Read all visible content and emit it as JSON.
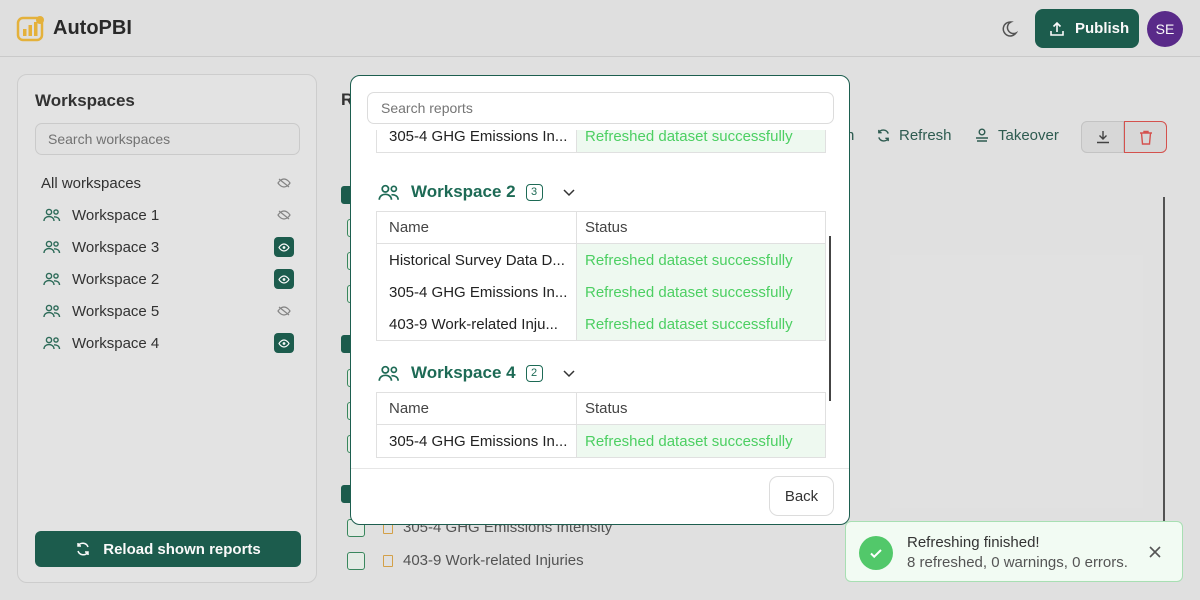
{
  "app": {
    "title": "AutoPBI"
  },
  "header": {
    "publish_label": "Publish",
    "avatar_initials": "SE"
  },
  "sidebar": {
    "title": "Workspaces",
    "search_placeholder": "Search workspaces",
    "all_label": "All workspaces",
    "items": [
      {
        "label": "Workspace 1",
        "visible": false
      },
      {
        "label": "Workspace 3",
        "visible": true
      },
      {
        "label": "Workspace 2",
        "visible": true
      },
      {
        "label": "Workspace 5",
        "visible": false
      },
      {
        "label": "Workspace 4",
        "visible": true
      }
    ],
    "reload_label": "Reload shown reports"
  },
  "main": {
    "title_partial": "R",
    "toolbar": {
      "partial_label": "n",
      "refresh_label": "Refresh",
      "takeover_label": "Takeover"
    },
    "rows": [
      "305-4 GHG Emissions Intensity",
      "403-9 Work-related Injuries"
    ]
  },
  "modal": {
    "search_placeholder": "Search reports",
    "top_row": {
      "name": "305-4 GHG Emissions In...",
      "status": "Refreshed dataset successfully"
    },
    "groups": [
      {
        "name": "Workspace 2",
        "count": "3",
        "col_name": "Name",
        "col_status": "Status",
        "rows": [
          {
            "name": "Historical Survey Data D...",
            "status": "Refreshed dataset successfully"
          },
          {
            "name": "305-4 GHG Emissions In...",
            "status": "Refreshed dataset successfully"
          },
          {
            "name": "403-9 Work-related Inju...",
            "status": "Refreshed dataset successfully"
          }
        ]
      },
      {
        "name": "Workspace 4",
        "count": "2",
        "col_name": "Name",
        "col_status": "Status",
        "rows": [
          {
            "name": "305-4 GHG Emissions In...",
            "status": "Refreshed dataset successfully"
          }
        ]
      }
    ],
    "back_label": "Back"
  },
  "toast": {
    "title": "Refreshing finished!",
    "message": "8 refreshed, 0 warnings, 0 errors."
  },
  "colors": {
    "primary": "#1d5e4f",
    "success": "#4ccf62",
    "avatar": "#5b2b8c"
  }
}
